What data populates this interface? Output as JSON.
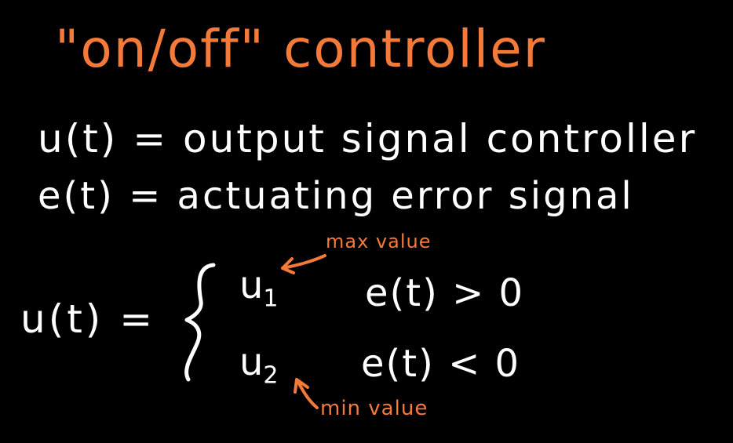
{
  "colors": {
    "background": "#000000",
    "ink": "#ffffff",
    "accent": "#f47a3a"
  },
  "notes": {
    "title": "\"on/off\" controller",
    "definitions": [
      "u(t) = output signal controller",
      "e(t) = actuating error signal"
    ],
    "equation": {
      "lhs": "u(t) =",
      "cases": [
        {
          "value": "u",
          "subscript": "1",
          "condition": "e(t) > 0"
        },
        {
          "value": "u",
          "subscript": "2",
          "condition": "e(t) < 0"
        }
      ]
    },
    "annotations": {
      "max": "max value",
      "min": "min value"
    }
  }
}
